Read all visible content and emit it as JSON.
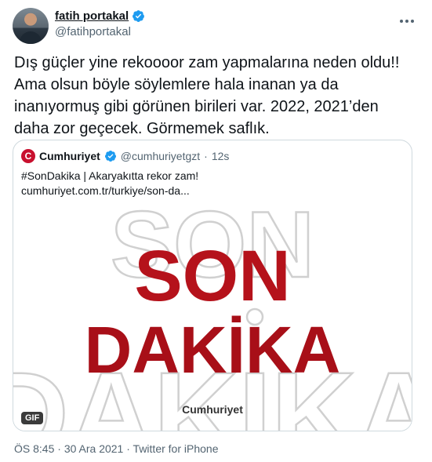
{
  "author": {
    "display_name": "fatih portakal",
    "handle": "@fatihportakal",
    "verified": true
  },
  "more_icon": "more-horizontal-icon",
  "tweet": {
    "text_lines": [
      "Dış güçler yine rekoooor zam yapmalarına neden oldu!!",
      "Ama olsun böyle söylemlere hala inanan ya da",
      "inanıyormuş gibi görünen birileri var. 2022, 2021’den",
      "daha zor geçecek. Görmemek saflık."
    ]
  },
  "quoted": {
    "logo_letter": "C",
    "name": "Cumhuriyet",
    "handle": "@cumhuriyetgzt",
    "separator": "·",
    "time": "12s",
    "text_lines": [
      "#SonDakika | Akaryakıtta rekor zam!",
      "cumhuriyet.com.tr/turkiye/son-da..."
    ],
    "media": {
      "line1": "SON",
      "line2": "DAKİKA",
      "outline_top": "SON",
      "outline_bottom": "DAKIKA",
      "brand": "Cumhuriyet",
      "gif_badge": "GIF"
    }
  },
  "meta": {
    "time": "ÖS 8:45",
    "date": "30 Ara 2021",
    "source": "Twitter for iPhone",
    "sep": "·"
  },
  "colors": {
    "accent_blue": "#1d9bf0",
    "headline_red": "#b5121b",
    "brand_red": "#c8102e"
  }
}
